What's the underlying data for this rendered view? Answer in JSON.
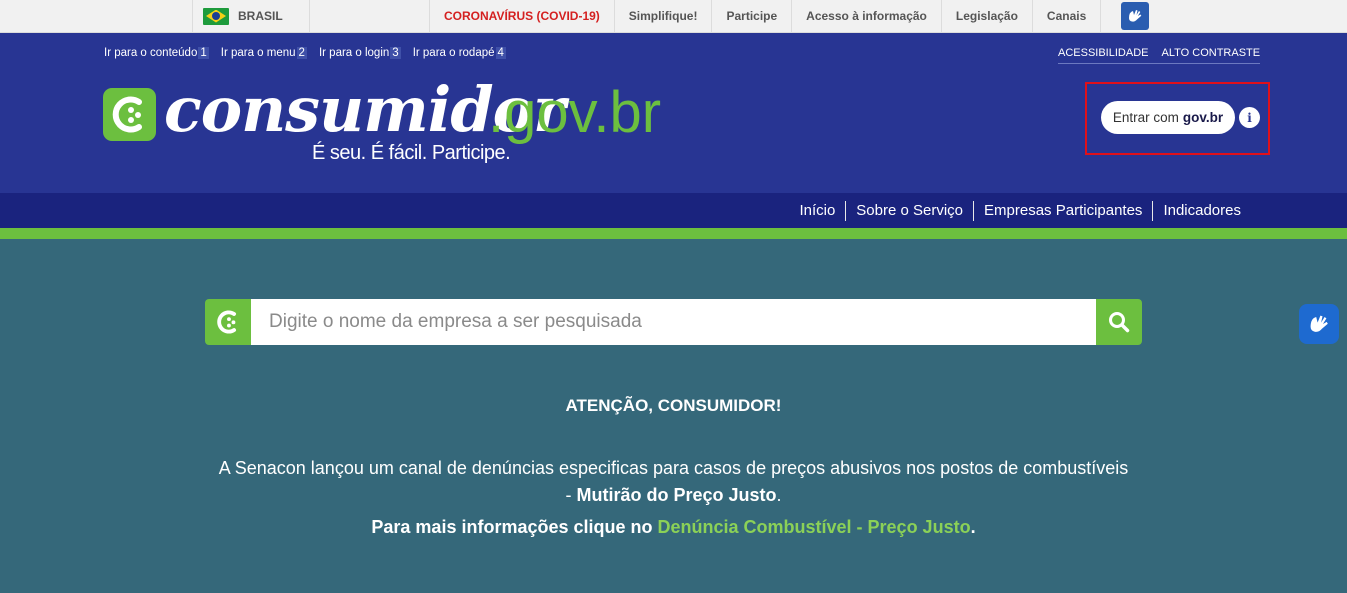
{
  "gov_bar": {
    "country": "BRASIL",
    "links": [
      "CORONAVÍRUS (COVID-19)",
      "Simplifique!",
      "Participe",
      "Acesso à informação",
      "Legislação",
      "Canais"
    ]
  },
  "skip_links": [
    {
      "label": "Ir para o conteúdo",
      "key": "1"
    },
    {
      "label": "Ir para o menu",
      "key": "2"
    },
    {
      "label": "Ir para o login",
      "key": "3"
    },
    {
      "label": "Ir para o rodapé",
      "key": "4"
    }
  ],
  "accessibility": {
    "a11y": "ACESSIBILIDADE",
    "contrast": "ALTO CONTRASTE"
  },
  "logo": {
    "main": "consumidor",
    "domain": ".gov.br",
    "slogan": "É seu. É fácil. Participe."
  },
  "login": {
    "prefix": "Entrar com",
    "brand": "gov.br",
    "info_icon": "i"
  },
  "nav": [
    "Início",
    "Sobre o Serviço",
    "Empresas Participantes",
    "Indicadores"
  ],
  "search": {
    "placeholder": "Digite o nome da empresa a ser pesquisada"
  },
  "notice": {
    "title": "ATENÇÃO, CONSUMIDOR!",
    "body_line1": "A Senacon lançou um canal de denúncias especificas para casos de preços abusivos nos postos de combustíveis",
    "body_line2_prefix": "- ",
    "body_line2_bold": "Mutirão do Preço Justo",
    "body_line2_suffix": ".",
    "more_prefix": "Para mais informações clique no ",
    "more_link": "Denúncia Combustível - Preço Justo",
    "more_suffix": "."
  },
  "colors": {
    "header": "#283593",
    "nav": "#1a237e",
    "accent": "#6cbf3f",
    "body": "#35687a",
    "alert": "#d42020"
  }
}
